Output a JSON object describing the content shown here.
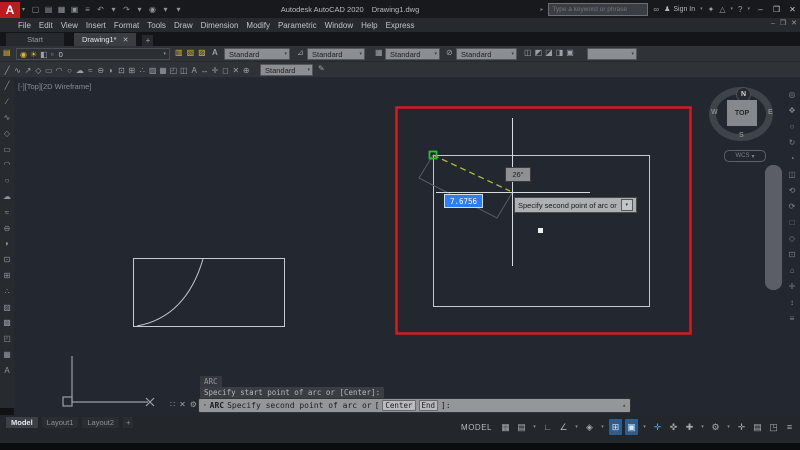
{
  "titlebar": {
    "logo_letter": "A",
    "logo_caret": "▾",
    "qat_icons": [
      "▢",
      "▤",
      "▦",
      "▣",
      "≡",
      "↶",
      "▾",
      "↷",
      "▾",
      "◉",
      "▾",
      "▾"
    ],
    "app_title": "Autodesk AutoCAD 2020",
    "doc_title": "Drawing1.dwg",
    "search_marker": "▸",
    "search_placeholder": "Type a keyword or phrase",
    "binoculars_icon": "∞",
    "user_icon": "♟",
    "sign_in": "Sign In",
    "menu_caret": "▾",
    "appstore_icon": "✦",
    "alert_icon": "△",
    "help_icon": "?",
    "min_icon": "–",
    "restore_icon": "❐",
    "close_icon": "✕"
  },
  "menubar": {
    "items": [
      "File",
      "Edit",
      "View",
      "Insert",
      "Format",
      "Tools",
      "Draw",
      "Dimension",
      "Modify",
      "Parametric",
      "Window",
      "Help",
      "Express"
    ],
    "doc_min": "–",
    "doc_restore": "❐",
    "doc_close": "✕"
  },
  "file_tabs": {
    "start": "Start",
    "active": "Drawing1*",
    "close_icon": "✕",
    "add_icon": "+"
  },
  "toolbar1": {
    "layers_icon": "▤",
    "bulb_icon": "◉",
    "sun_icon": "☀",
    "lock_icon": "◧",
    "swatch_icon": "▫",
    "layer_value": "0",
    "caret": "▾",
    "tool_icons": [
      "▥",
      "▧",
      "▨"
    ],
    "text_style_icon": "A",
    "text_style_value": "Standard",
    "dim_icon": "⊿",
    "dim_style_value": "Standard",
    "table_icon": "▦",
    "table_style_value": "Standard",
    "mleader_icon": "⊘",
    "mleader_style_value": "Standard",
    "group_icons": [
      "◫",
      "◩",
      "◪",
      "◨",
      "▣"
    ],
    "empty_value": ""
  },
  "toolbar2": {
    "icons": [
      "╱",
      "∿",
      "↗",
      "◇",
      "▭",
      "◠",
      "○",
      "☁",
      "≈",
      "⊖",
      "◗",
      "⊡",
      "⊞",
      "∴",
      "▨",
      "▦",
      "◰",
      "◫",
      "A",
      "↔",
      "✛",
      "◻",
      "✕",
      "⊕"
    ],
    "combo_value": "Standard",
    "end_icon": "✎"
  },
  "left_toolbar": {
    "icons": [
      "╱",
      "∕",
      "∿",
      "◇",
      "▭",
      "◠",
      "○",
      "☁",
      "≈",
      "⊖",
      "◗",
      "⊡",
      "⊞",
      "∴",
      "▨",
      "▩",
      "◰",
      "▦",
      "A"
    ]
  },
  "right_toolbar": {
    "icons": [
      "◎",
      "✥",
      "○",
      "↻",
      "◔",
      "◫",
      "⟲",
      "⟳",
      "□",
      "◇",
      "⊡",
      "⌂",
      "✛",
      "↕",
      "≡"
    ]
  },
  "viewport": {
    "label": "[-][Top][2D Wireframe]"
  },
  "viewcube": {
    "north": "N",
    "south": "S",
    "east": "E",
    "west": "W",
    "face": "TOP",
    "wcs": "WCS",
    "wcs_caret": "▾"
  },
  "drawing": {
    "angle_label": "26°",
    "dyn_input_value": "7.6756",
    "tooltip_text": "Specify second point of arc or",
    "tooltip_caret": "▾"
  },
  "command": {
    "history_cmd": "ARC",
    "history_prompt": "Specify start point of arc or [Center]:",
    "grip_icon": "∷",
    "close_icon": "✕",
    "wrench_icon": "⚙",
    "prompt_caret": "▾",
    "prompt_cmd": "ARC",
    "prompt_text": "Specify second point of arc or",
    "bracket_open": "[",
    "option_center": "Center",
    "option_end": "End",
    "bracket_close": "]:",
    "expand_icon": "▴"
  },
  "layout_tabs": {
    "items": [
      {
        "label": "Model",
        "cls": "active"
      },
      {
        "label": "Layout1"
      },
      {
        "label": "Layout2"
      },
      {
        "label": "+",
        "cls": "add"
      }
    ]
  },
  "statusbar": {
    "model_label": "MODEL",
    "icons": [
      {
        "g": "▦"
      },
      {
        "g": "▤"
      },
      {
        "g": "▾",
        "cls": "caret"
      },
      {
        "g": "∟"
      },
      {
        "g": "∠"
      },
      {
        "g": "▾",
        "cls": "caret"
      },
      {
        "g": "◈"
      },
      {
        "g": "▾",
        "cls": "caret"
      },
      {
        "g": "⊞",
        "cls": "on"
      },
      {
        "g": "▣",
        "cls": "on"
      },
      {
        "g": "▾",
        "cls": "caret"
      },
      {
        "g": "✛",
        "cls": "blue"
      },
      {
        "g": "✜"
      },
      {
        "g": "✚"
      },
      {
        "g": "▾",
        "cls": "caret"
      },
      {
        "g": "⚙"
      },
      {
        "g": "▾",
        "cls": "caret"
      },
      {
        "g": "✛"
      },
      {
        "g": "▤"
      },
      {
        "g": "◳"
      },
      {
        "g": "≡"
      }
    ]
  },
  "colors": {
    "accent_red": "#d31d1d",
    "select_blue": "#2e7cf6",
    "snap_green": "#2fbf3a",
    "rubberband_olive": "#b5ba3c"
  }
}
